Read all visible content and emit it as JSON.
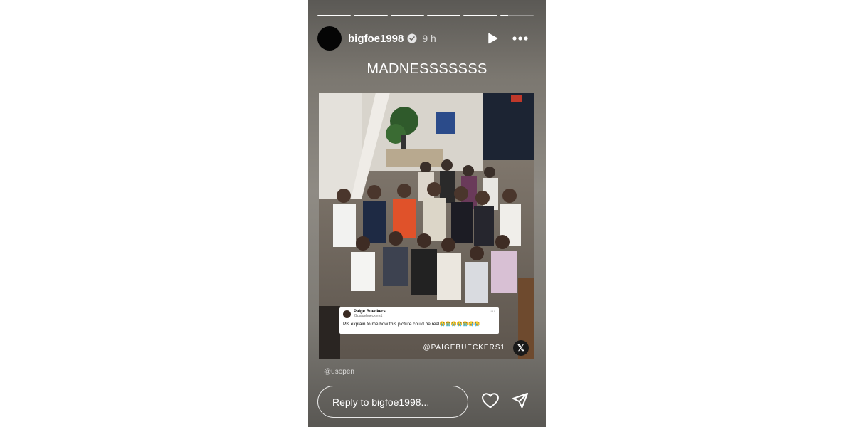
{
  "story": {
    "progress": [
      1,
      1,
      1,
      1,
      1,
      0.25
    ],
    "username": "bigfoe1998",
    "time": "9 h",
    "caption": "MADNESSSSSSS",
    "mention": "@usopen",
    "reply_placeholder": "Reply to bigfoe1998..."
  },
  "post": {
    "tweet": {
      "name": "Paige Bueckers",
      "handle": "@paigebueckers1",
      "text": "Pls explain to me how this picture could be real😭😭😭😭😭😭😭"
    },
    "watermark": "@PAIGEBUECKERS1",
    "x_logo": "𝕏"
  },
  "icons": {
    "verified": "verified-badge-icon",
    "play": "play-icon",
    "more": "more-icon",
    "heart": "heart-icon",
    "send": "send-icon"
  }
}
